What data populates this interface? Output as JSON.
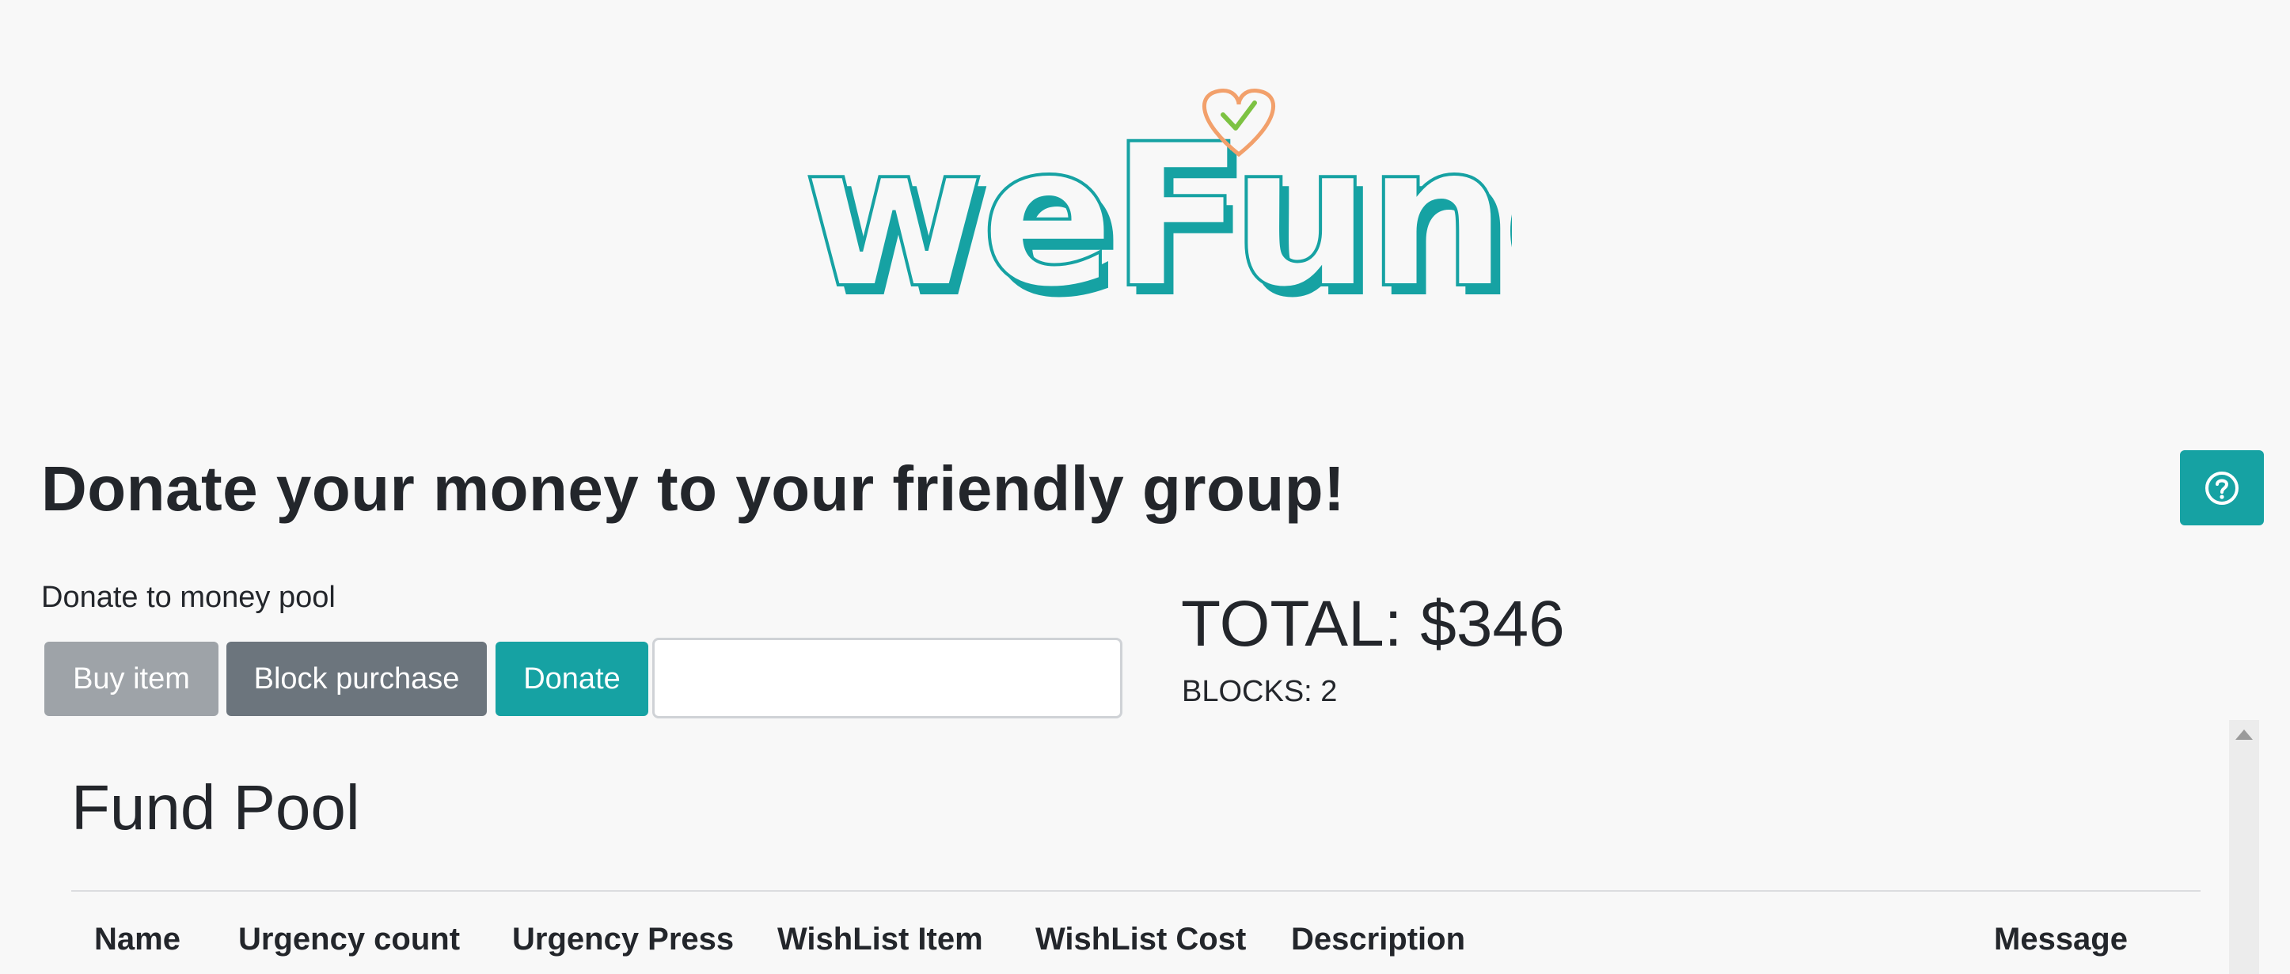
{
  "logo": {
    "text": "weFund",
    "color": "#16a2a3",
    "heart_color": "#f2a06b",
    "check_color": "#7dc242"
  },
  "help": {
    "icon": "question-circle-icon"
  },
  "heading": "Donate your money to your friendly group!",
  "donate": {
    "label": "Donate to money pool",
    "buy_label": "Buy item",
    "block_label": "Block purchase",
    "donate_label": "Donate",
    "amount_value": ""
  },
  "stats": {
    "total": "TOTAL: $346",
    "blocks": "BLOCKS: 2"
  },
  "fund_pool": {
    "title": "Fund Pool",
    "columns": [
      "Name",
      "Urgency count",
      "Urgency Press",
      "WishList Item",
      "WishList Cost",
      "Description",
      "Message"
    ]
  },
  "colors": {
    "accent": "#16a2a3",
    "secondary": "#6c757d",
    "muted": "#9ea3a8",
    "background": "#f8f8f8"
  }
}
